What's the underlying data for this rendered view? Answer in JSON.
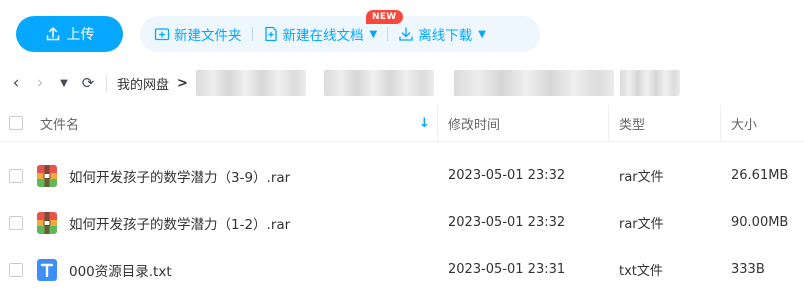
{
  "toolbar": {
    "upload_label": "上传",
    "new_folder_label": "新建文件夹",
    "new_online_doc_label": "新建在线文档",
    "new_badge": "NEW",
    "offline_download_label": "离线下载"
  },
  "breadcrumb": {
    "root": "我的网盘",
    "separator": ">"
  },
  "table": {
    "headers": {
      "name": "文件名",
      "modified": "修改时间",
      "type": "类型",
      "size": "大小"
    },
    "rows": [
      {
        "name": "如何开发孩子的数学潜力（3-9）.rar",
        "modified": "2023-05-01 23:32",
        "type": "rar文件",
        "size": "26.61MB",
        "icon": "rar-file-icon"
      },
      {
        "name": "如何开发孩子的数学潜力（1-2）.rar",
        "modified": "2023-05-01 23:32",
        "type": "rar文件",
        "size": "90.00MB",
        "icon": "rar-file-icon"
      },
      {
        "name": "000资源目录.txt",
        "modified": "2023-05-01 23:31",
        "type": "txt文件",
        "size": "333B",
        "icon": "txt-file-icon"
      }
    ]
  },
  "colors": {
    "accent": "#06a7ff",
    "pill_bg": "#eef6fe",
    "badge_red": "#f9473c"
  }
}
